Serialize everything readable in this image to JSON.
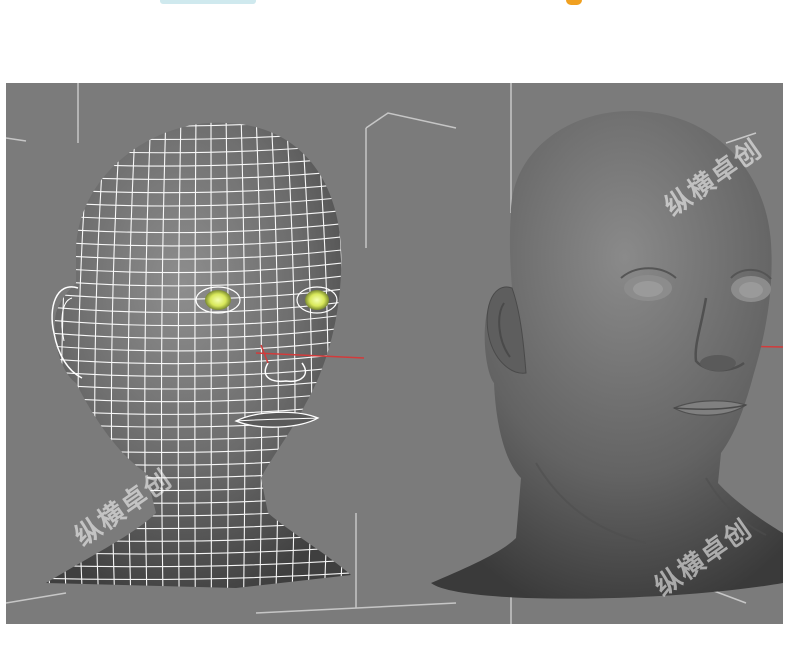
{
  "watermark": {
    "text": "纵横卓创"
  },
  "colors": {
    "viewport_bg": "#7b7b7b",
    "wire": "#ffffff",
    "eye_glow": "#d8e85a",
    "axis_red": "#d23b3b",
    "shaded_head": "#6a6a6a"
  }
}
